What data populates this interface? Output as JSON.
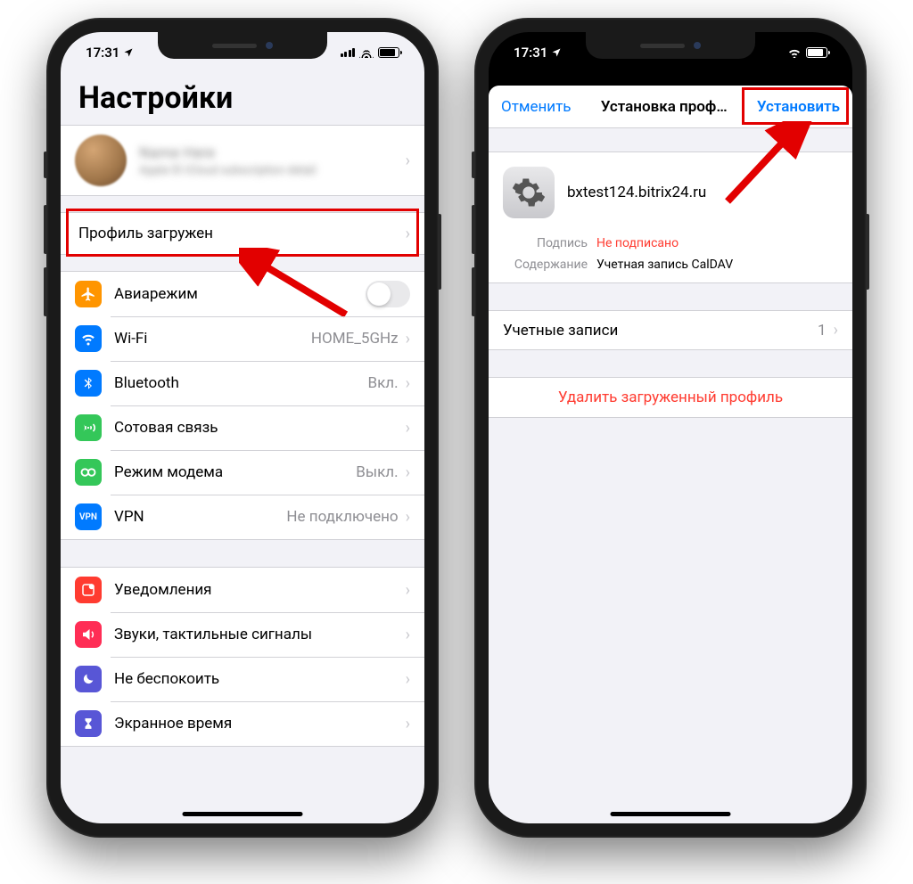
{
  "status": {
    "time": "17:31"
  },
  "left": {
    "title": "Настройки",
    "profile_loaded": "Профиль загружен",
    "rows": {
      "airplane": "Авиарежим",
      "wifi": "Wi-Fi",
      "wifi_detail": "HOME_5GHz",
      "bluetooth": "Bluetooth",
      "bluetooth_detail": "Вкл.",
      "cellular": "Сотовая связь",
      "hotspot": "Режим модема",
      "hotspot_detail": "Выкл.",
      "vpn": "VPN",
      "vpn_detail": "Не подключено",
      "notifications": "Уведомления",
      "sounds": "Звуки, тактильные сигналы",
      "dnd": "Не беспокоить",
      "screentime": "Экранное время"
    }
  },
  "right": {
    "cancel": "Отменить",
    "title": "Установка проф…",
    "install": "Установить",
    "profile_name": "bxtest124.bitrix24.ru",
    "signature_label": "Подпись",
    "signature_value": "Не подписано",
    "content_label": "Содержание",
    "content_value": "Учетная запись CalDAV",
    "accounts": "Учетные записи",
    "accounts_count": "1",
    "delete": "Удалить загруженный профиль"
  }
}
